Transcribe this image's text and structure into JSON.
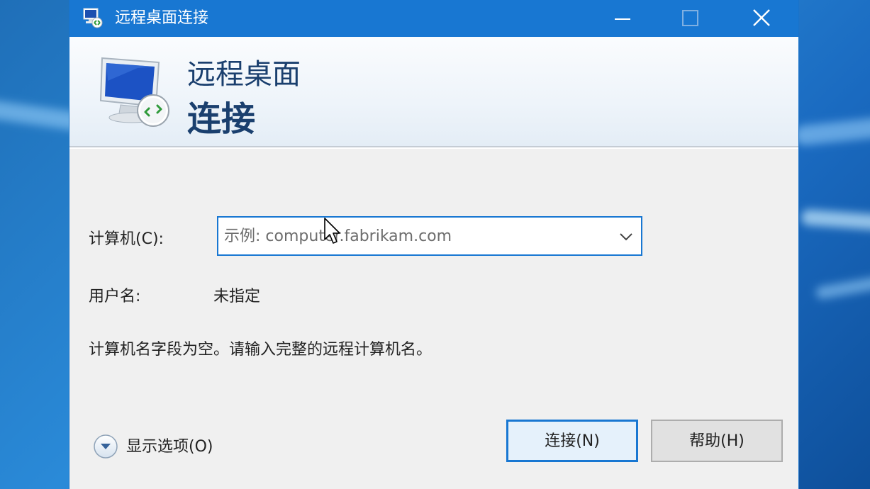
{
  "window": {
    "title": "远程桌面连接"
  },
  "header": {
    "line1": "远程桌面",
    "line2": "连接"
  },
  "form": {
    "computer_label": "计算机(C):",
    "computer_placeholder": "示例: computer.fabrikam.com",
    "username_label": "用户名:",
    "username_value": "未指定",
    "message": "计算机名字段为空。请输入完整的远程计算机名。"
  },
  "footer": {
    "show_options_label": "显示选项(O)",
    "connect_label": "连接(N)",
    "help_label": "帮助(H)"
  },
  "colors": {
    "titlebar": "#1877d2",
    "heading": "#1a3f6e",
    "accent": "#1877d2"
  },
  "icons": {
    "title": "remote-desktop-icon",
    "header": "remote-desktop-monitor-icon",
    "minimize": "minimize-icon",
    "maximize": "maximize-icon",
    "close": "close-icon",
    "dropdown": "chevron-down-icon",
    "options": "expand-circle-icon",
    "cursor": "mouse-cursor-icon"
  }
}
